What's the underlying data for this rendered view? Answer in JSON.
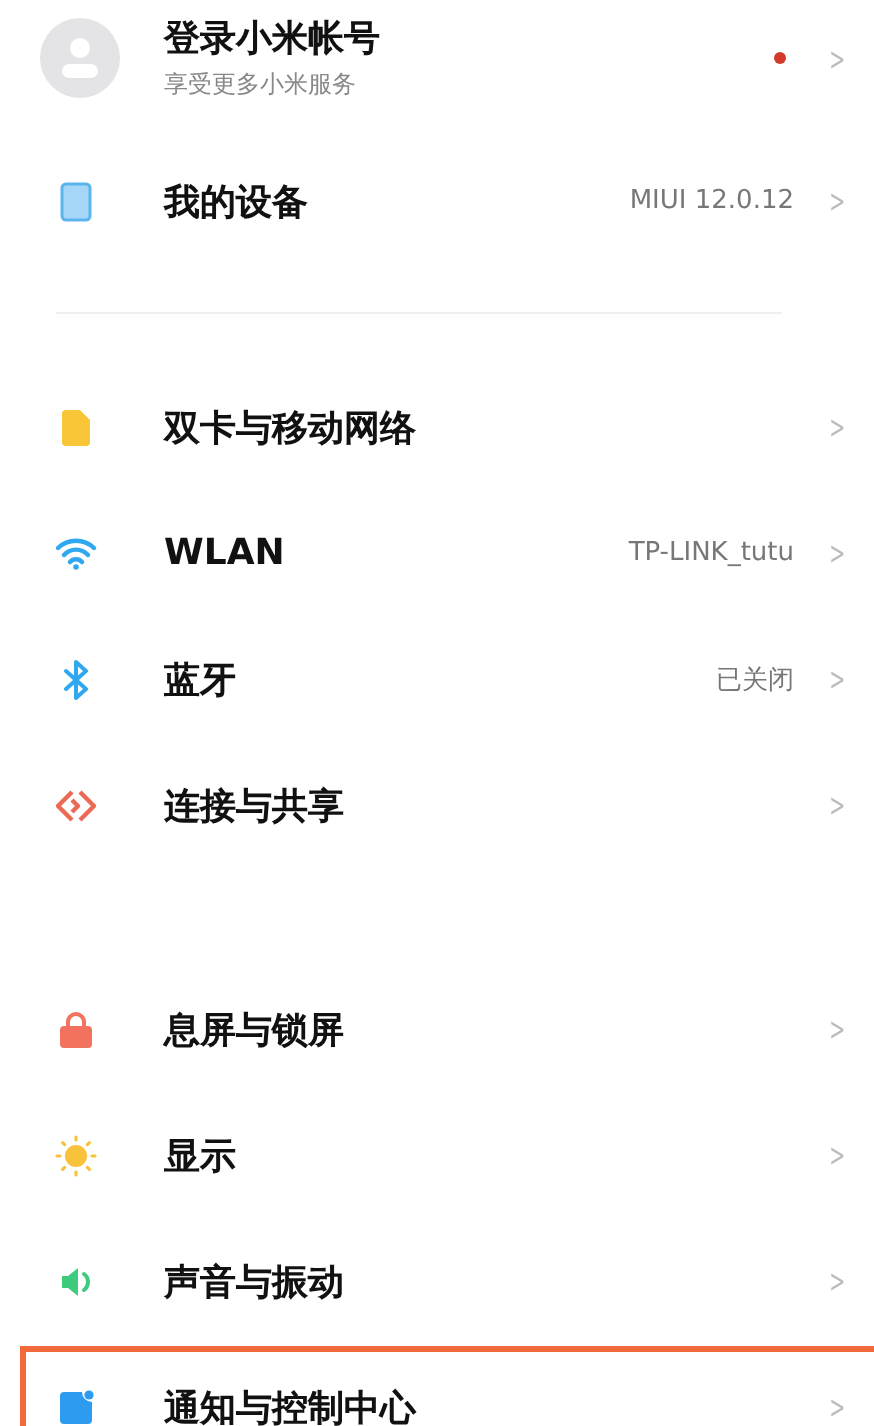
{
  "account": {
    "title": "登录小米帐号",
    "subtitle": "享受更多小米服务",
    "notification_dot": true,
    "chevron": ">"
  },
  "sections": [
    {
      "divider_after": true,
      "items": [
        {
          "kind": "device",
          "label": "我的设备",
          "value": "MIUI 12.0.12",
          "highlighted": false
        }
      ]
    },
    {
      "divider_after": false,
      "items": [
        {
          "kind": "sim",
          "label": "双卡与移动网络",
          "highlighted": false
        },
        {
          "kind": "wifi",
          "label": "WLAN",
          "value": "TP-LINK_tutu",
          "highlighted": false
        },
        {
          "kind": "bluetooth",
          "label": "蓝牙",
          "value": "已关闭",
          "highlighted": false
        },
        {
          "kind": "share",
          "label": "连接与共享",
          "highlighted": false
        }
      ]
    },
    {
      "divider_after": false,
      "items": [
        {
          "kind": "lock",
          "label": "息屏与锁屏",
          "highlighted": false
        },
        {
          "kind": "display",
          "label": "显示",
          "highlighted": false
        },
        {
          "kind": "sound",
          "label": "声音与振动",
          "highlighted": false
        },
        {
          "kind": "notification",
          "label": "通知与控制中心",
          "highlighted": true
        }
      ]
    }
  ]
}
